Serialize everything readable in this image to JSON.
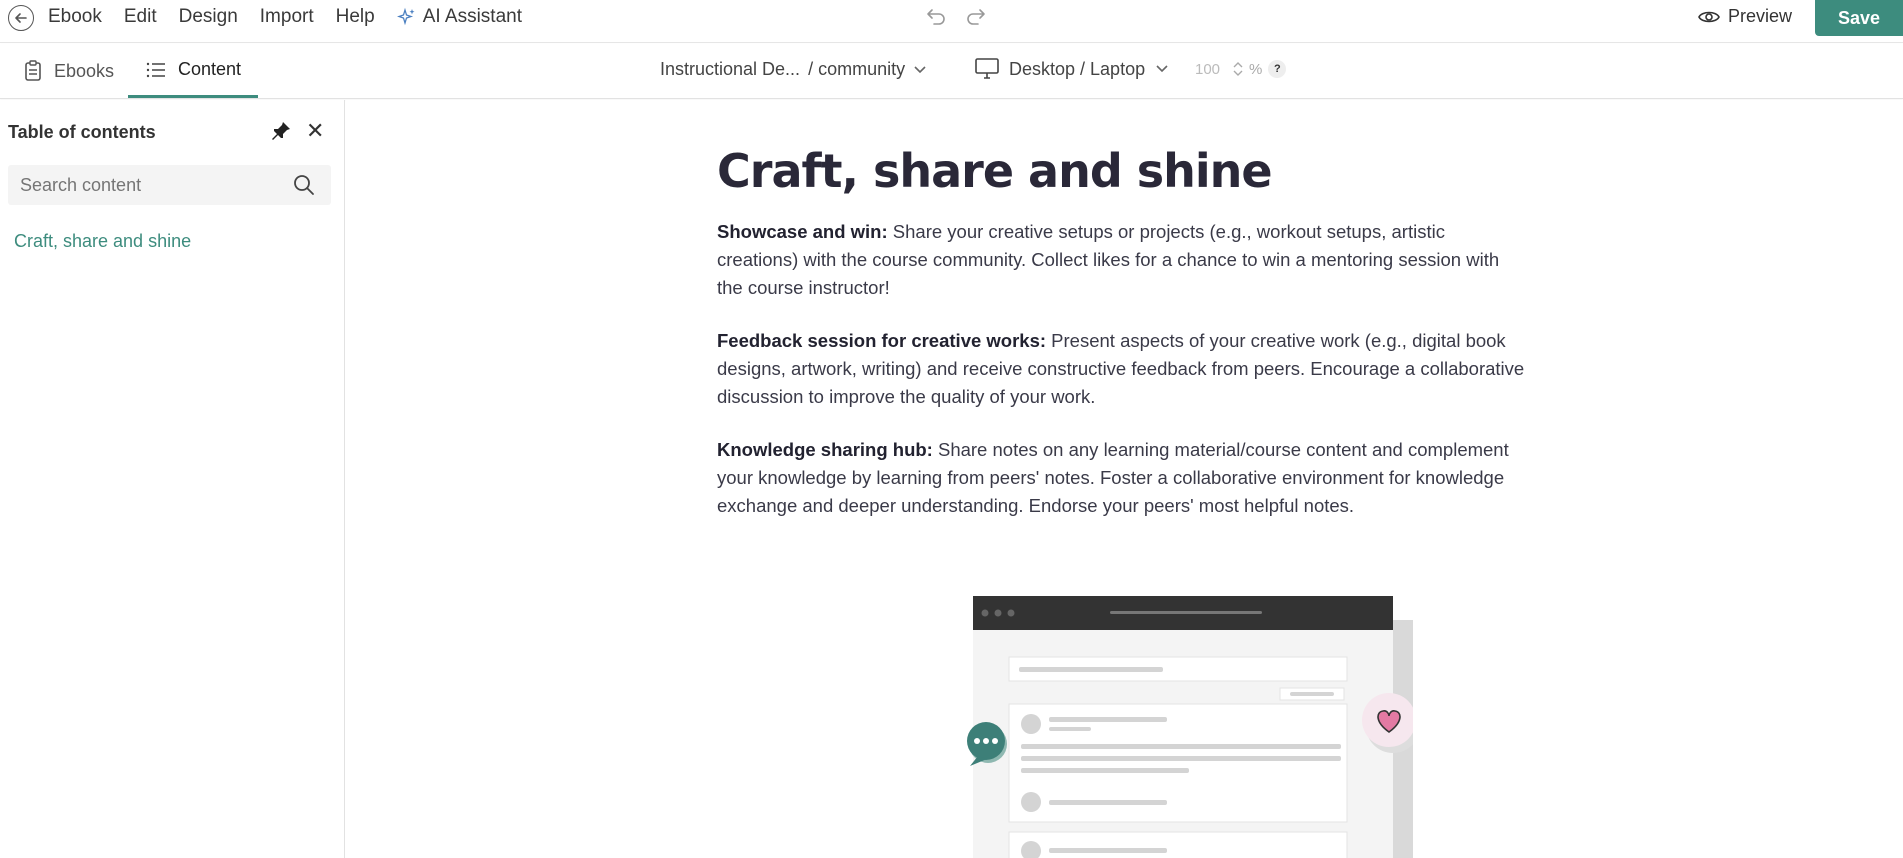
{
  "topbar": {
    "menu": [
      "Ebook",
      "Edit",
      "Design",
      "Import",
      "Help"
    ],
    "ai_assistant": "AI Assistant",
    "preview": "Preview",
    "save": "Save"
  },
  "subbar": {
    "tabs": [
      {
        "label": "Ebooks",
        "icon": "clipboard-icon"
      },
      {
        "label": "Content",
        "icon": "list-icon",
        "active": true
      }
    ],
    "path_left": "Instructional De...",
    "path_right": "/ community",
    "device": "Desktop / Laptop",
    "zoom_value": "100",
    "zoom_unit": "%",
    "help": "?"
  },
  "sidebar": {
    "title": "Table of contents",
    "search_placeholder": "Search content",
    "items": [
      "Craft, share and shine"
    ]
  },
  "article": {
    "title": "Craft, share and shine",
    "paragraphs": [
      {
        "lead": "Showcase and win:",
        "text": " Share your creative setups or projects (e.g., workout setups, artistic creations) with the course community. Collect likes for a chance to win a mentoring session with the course instructor!"
      },
      {
        "lead": "Feedback session for creative works:",
        "text": " Present aspects of your creative work (e.g., digital book designs, artwork, writing) and receive constructive feedback from peers. Encourage a collaborative discussion to improve the quality of your work."
      },
      {
        "lead": "Knowledge sharing hub:",
        "text": " Share notes on any learning material/course content and complement your knowledge by learning from peers' notes. Foster a collaborative environment for knowledge exchange and deeper understanding. Endorse your peers' most helpful notes."
      }
    ]
  },
  "colors": {
    "accent": "#3d8c7e",
    "heading": "#2a2838",
    "heart": "#e37aa3"
  }
}
